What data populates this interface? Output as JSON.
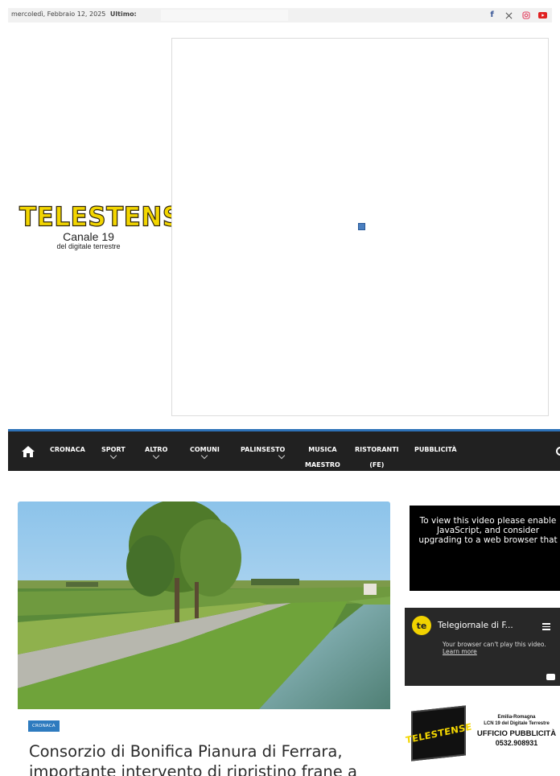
{
  "topbar": {
    "date": "mercoledì, Febbraio 12, 2025",
    "latest_label": "Ultimo:",
    "socials": [
      {
        "name": "facebook",
        "glyph": "f"
      },
      {
        "name": "x",
        "glyph": "𝕏"
      },
      {
        "name": "instagram",
        "glyph": "◎"
      },
      {
        "name": "youtube",
        "glyph": "▶"
      }
    ]
  },
  "logo": {
    "word": "TELESTENSE",
    "line1": "Canale 19",
    "line2": "del digitale terrestre"
  },
  "nav": {
    "items": [
      {
        "label": "CRONACA",
        "label2": "",
        "dropdown": false
      },
      {
        "label": "SPORT",
        "label2": "",
        "dropdown": true
      },
      {
        "label": "ALTRO",
        "label2": "",
        "dropdown": true
      },
      {
        "label": "COMUNI",
        "label2": "",
        "dropdown": true
      },
      {
        "label": "PALINSESTO",
        "label2": "",
        "dropdown": true
      },
      {
        "label": "MUSICA",
        "label2": "MAESTRO",
        "dropdown": false
      },
      {
        "label": "RISTORANTI",
        "label2": "(FE)",
        "dropdown": false
      },
      {
        "label": "PUBBLICITÀ",
        "label2": "",
        "dropdown": false
      }
    ]
  },
  "article": {
    "tag": "CRONACA",
    "title": "Consorzio di Bonifica Pianura di Ferrara, importante intervento di ripristino frane a"
  },
  "sidebar": {
    "video1_text": "To view this video please enable JavaScript, and consider upgrading to a web browser that",
    "video2": {
      "title": "Telegiornale di F...",
      "message": "Your browser can't play this video.",
      "learn_more": "Learn more"
    },
    "ad": {
      "logo_word": "TELESTENSE",
      "line1": "Emilia-Romagna",
      "line2": "LCN 19 del Digitale Terrestre",
      "line3": "UFFICIO PUBBLICITÀ",
      "line4": "0532.908931"
    }
  },
  "colors": {
    "nav_bg": "#212121",
    "nav_accent": "#2d72b8",
    "logo_yellow": "#f3d600",
    "tag_blue": "#2e7bbf"
  }
}
